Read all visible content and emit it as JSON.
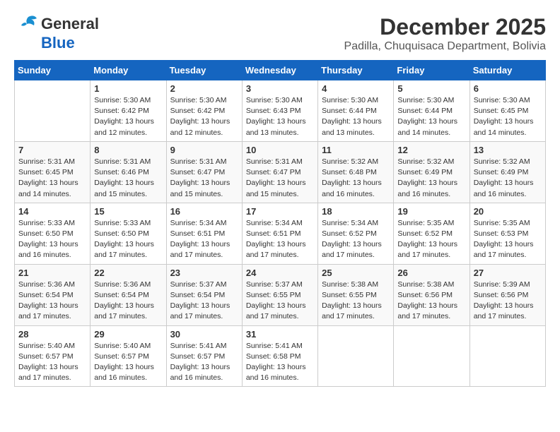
{
  "logo": {
    "line1": "General",
    "line2": "Blue"
  },
  "title": "December 2025",
  "subtitle": "Padilla, Chuquisaca Department, Bolivia",
  "days_header": [
    "Sunday",
    "Monday",
    "Tuesday",
    "Wednesday",
    "Thursday",
    "Friday",
    "Saturday"
  ],
  "weeks": [
    [
      {
        "num": "",
        "info": ""
      },
      {
        "num": "1",
        "info": "Sunrise: 5:30 AM\nSunset: 6:42 PM\nDaylight: 13 hours\nand 12 minutes."
      },
      {
        "num": "2",
        "info": "Sunrise: 5:30 AM\nSunset: 6:42 PM\nDaylight: 13 hours\nand 12 minutes."
      },
      {
        "num": "3",
        "info": "Sunrise: 5:30 AM\nSunset: 6:43 PM\nDaylight: 13 hours\nand 13 minutes."
      },
      {
        "num": "4",
        "info": "Sunrise: 5:30 AM\nSunset: 6:44 PM\nDaylight: 13 hours\nand 13 minutes."
      },
      {
        "num": "5",
        "info": "Sunrise: 5:30 AM\nSunset: 6:44 PM\nDaylight: 13 hours\nand 14 minutes."
      },
      {
        "num": "6",
        "info": "Sunrise: 5:30 AM\nSunset: 6:45 PM\nDaylight: 13 hours\nand 14 minutes."
      }
    ],
    [
      {
        "num": "7",
        "info": "Sunrise: 5:31 AM\nSunset: 6:45 PM\nDaylight: 13 hours\nand 14 minutes."
      },
      {
        "num": "8",
        "info": "Sunrise: 5:31 AM\nSunset: 6:46 PM\nDaylight: 13 hours\nand 15 minutes."
      },
      {
        "num": "9",
        "info": "Sunrise: 5:31 AM\nSunset: 6:47 PM\nDaylight: 13 hours\nand 15 minutes."
      },
      {
        "num": "10",
        "info": "Sunrise: 5:31 AM\nSunset: 6:47 PM\nDaylight: 13 hours\nand 15 minutes."
      },
      {
        "num": "11",
        "info": "Sunrise: 5:32 AM\nSunset: 6:48 PM\nDaylight: 13 hours\nand 16 minutes."
      },
      {
        "num": "12",
        "info": "Sunrise: 5:32 AM\nSunset: 6:49 PM\nDaylight: 13 hours\nand 16 minutes."
      },
      {
        "num": "13",
        "info": "Sunrise: 5:32 AM\nSunset: 6:49 PM\nDaylight: 13 hours\nand 16 minutes."
      }
    ],
    [
      {
        "num": "14",
        "info": "Sunrise: 5:33 AM\nSunset: 6:50 PM\nDaylight: 13 hours\nand 16 minutes."
      },
      {
        "num": "15",
        "info": "Sunrise: 5:33 AM\nSunset: 6:50 PM\nDaylight: 13 hours\nand 17 minutes."
      },
      {
        "num": "16",
        "info": "Sunrise: 5:34 AM\nSunset: 6:51 PM\nDaylight: 13 hours\nand 17 minutes."
      },
      {
        "num": "17",
        "info": "Sunrise: 5:34 AM\nSunset: 6:51 PM\nDaylight: 13 hours\nand 17 minutes."
      },
      {
        "num": "18",
        "info": "Sunrise: 5:34 AM\nSunset: 6:52 PM\nDaylight: 13 hours\nand 17 minutes."
      },
      {
        "num": "19",
        "info": "Sunrise: 5:35 AM\nSunset: 6:52 PM\nDaylight: 13 hours\nand 17 minutes."
      },
      {
        "num": "20",
        "info": "Sunrise: 5:35 AM\nSunset: 6:53 PM\nDaylight: 13 hours\nand 17 minutes."
      }
    ],
    [
      {
        "num": "21",
        "info": "Sunrise: 5:36 AM\nSunset: 6:54 PM\nDaylight: 13 hours\nand 17 minutes."
      },
      {
        "num": "22",
        "info": "Sunrise: 5:36 AM\nSunset: 6:54 PM\nDaylight: 13 hours\nand 17 minutes."
      },
      {
        "num": "23",
        "info": "Sunrise: 5:37 AM\nSunset: 6:54 PM\nDaylight: 13 hours\nand 17 minutes."
      },
      {
        "num": "24",
        "info": "Sunrise: 5:37 AM\nSunset: 6:55 PM\nDaylight: 13 hours\nand 17 minutes."
      },
      {
        "num": "25",
        "info": "Sunrise: 5:38 AM\nSunset: 6:55 PM\nDaylight: 13 hours\nand 17 minutes."
      },
      {
        "num": "26",
        "info": "Sunrise: 5:38 AM\nSunset: 6:56 PM\nDaylight: 13 hours\nand 17 minutes."
      },
      {
        "num": "27",
        "info": "Sunrise: 5:39 AM\nSunset: 6:56 PM\nDaylight: 13 hours\nand 17 minutes."
      }
    ],
    [
      {
        "num": "28",
        "info": "Sunrise: 5:40 AM\nSunset: 6:57 PM\nDaylight: 13 hours\nand 17 minutes."
      },
      {
        "num": "29",
        "info": "Sunrise: 5:40 AM\nSunset: 6:57 PM\nDaylight: 13 hours\nand 16 minutes."
      },
      {
        "num": "30",
        "info": "Sunrise: 5:41 AM\nSunset: 6:57 PM\nDaylight: 13 hours\nand 16 minutes."
      },
      {
        "num": "31",
        "info": "Sunrise: 5:41 AM\nSunset: 6:58 PM\nDaylight: 13 hours\nand 16 minutes."
      },
      {
        "num": "",
        "info": ""
      },
      {
        "num": "",
        "info": ""
      },
      {
        "num": "",
        "info": ""
      }
    ]
  ]
}
